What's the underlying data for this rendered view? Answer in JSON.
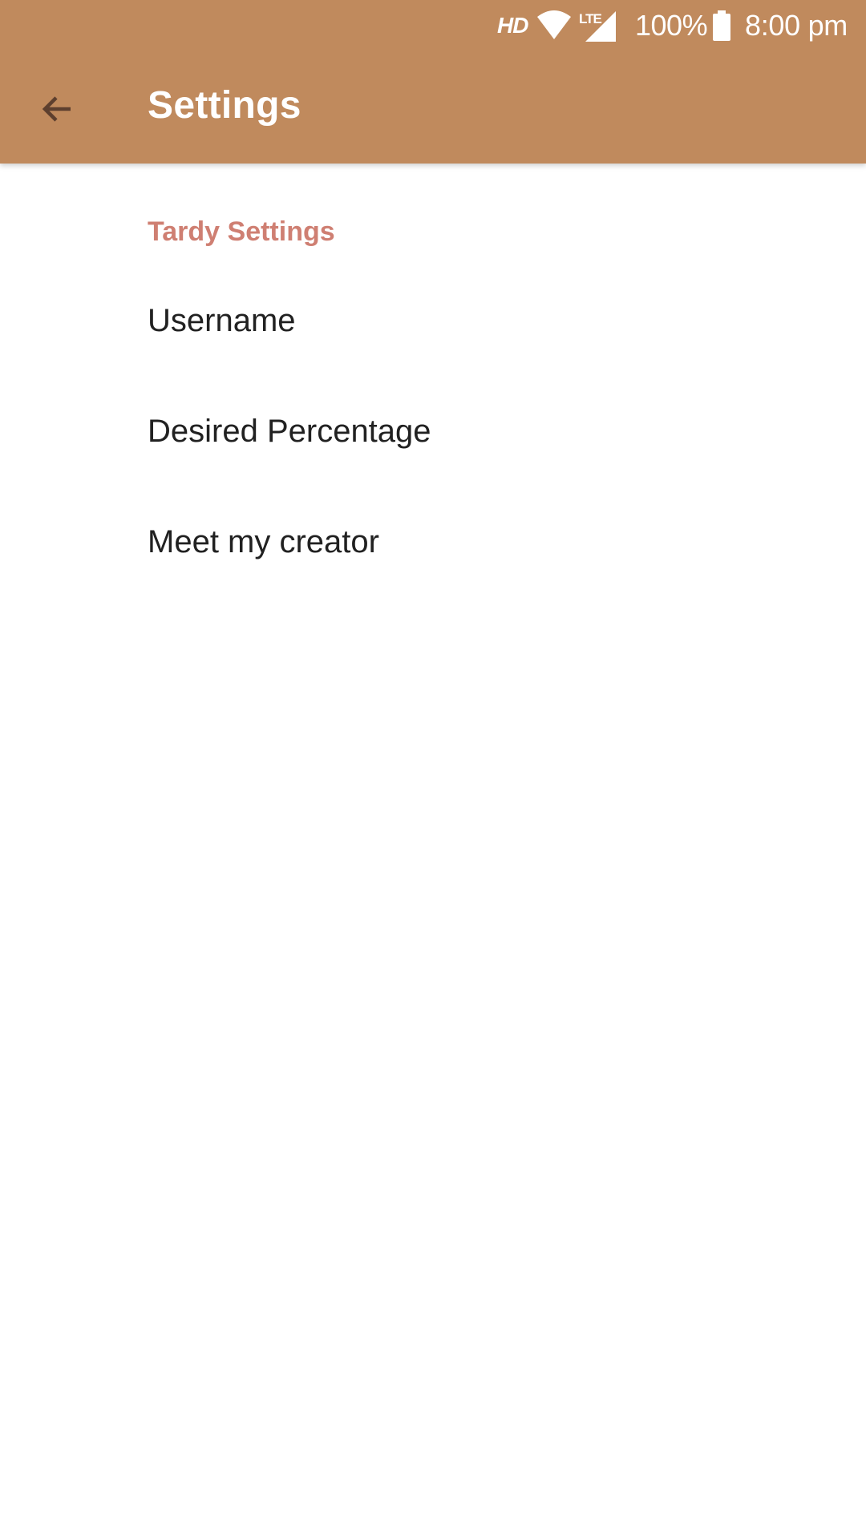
{
  "status_bar": {
    "hd": "HD",
    "network": "LTE",
    "battery": "100%",
    "time": "8:00 pm",
    "icons": [
      "wifi-icon",
      "lte-signal-icon",
      "battery-icon"
    ]
  },
  "toolbar": {
    "back_icon": "arrow-back-icon",
    "title": "Settings",
    "color": "#c08a5d"
  },
  "settings": {
    "section_title": "Tardy Settings",
    "section_color": "#cf7f72",
    "items": [
      {
        "label": "Username"
      },
      {
        "label": "Desired Percentage"
      },
      {
        "label": "Meet my creator"
      }
    ]
  }
}
